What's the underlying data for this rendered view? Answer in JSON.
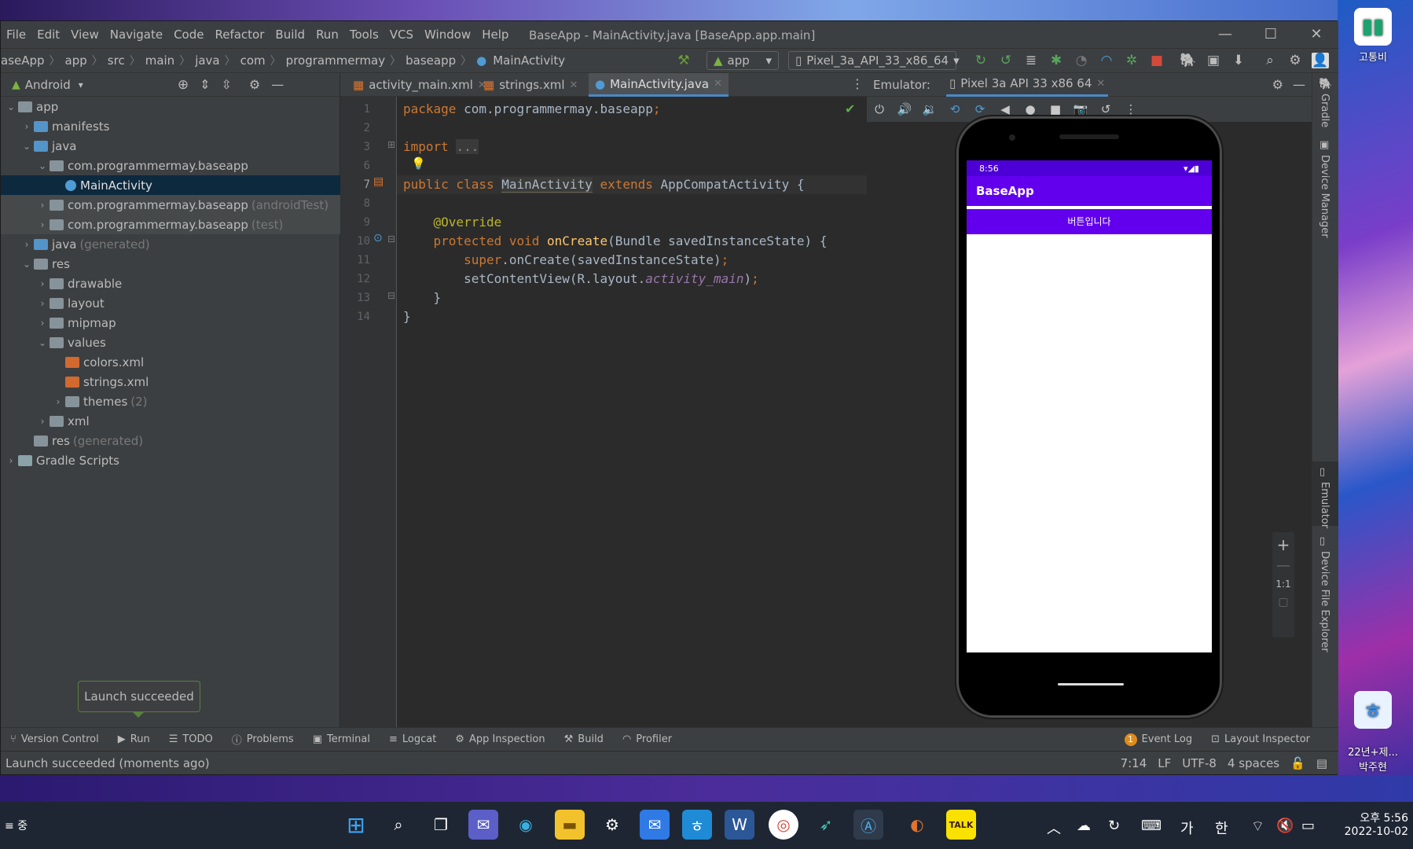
{
  "desktop": {
    "icons": [
      {
        "label": "고통비",
        "icon": "chart-icon",
        "color": "#1aa36f"
      },
      {
        "label": "22년+제...\n박주현",
        "icon": "hwp-icon",
        "color": "#3a8ee6"
      }
    ]
  },
  "menubar": {
    "items": [
      "File",
      "Edit",
      "View",
      "Navigate",
      "Code",
      "Refactor",
      "Build",
      "Run",
      "Tools",
      "VCS",
      "Window",
      "Help"
    ],
    "title": "BaseApp - MainActivity.java [BaseApp.app.main]"
  },
  "navbar": {
    "crumbs": [
      "aseApp",
      "app",
      "src",
      "main",
      "java",
      "com",
      "programmermay",
      "baseapp",
      "MainActivity"
    ],
    "run_config": "app",
    "device": "Pixel_3a_API_33_x86_64"
  },
  "project": {
    "view_label": "Android",
    "tree": [
      {
        "label": "app",
        "hint": "",
        "indent": 0,
        "arrow": "v",
        "icon": "module"
      },
      {
        "label": "manifests",
        "hint": "",
        "indent": 1,
        "arrow": ">",
        "icon": "folder-blue"
      },
      {
        "label": "java",
        "hint": "",
        "indent": 1,
        "arrow": "v",
        "icon": "folder-blue"
      },
      {
        "label": "com.programmermay.baseapp",
        "hint": "",
        "indent": 2,
        "arrow": "v",
        "icon": "folder"
      },
      {
        "label": "MainActivity",
        "hint": "",
        "indent": 3,
        "arrow": "",
        "icon": "class"
      },
      {
        "label": "com.programmermay.baseapp",
        "hint": "(androidTest)",
        "indent": 2,
        "arrow": ">",
        "icon": "folder"
      },
      {
        "label": "com.programmermay.baseapp",
        "hint": "(test)",
        "indent": 2,
        "arrow": ">",
        "icon": "folder"
      },
      {
        "label": "java",
        "hint": "(generated)",
        "indent": 1,
        "arrow": ">",
        "icon": "folder-blue"
      },
      {
        "label": "res",
        "hint": "",
        "indent": 1,
        "arrow": "v",
        "icon": "folder"
      },
      {
        "label": "drawable",
        "hint": "",
        "indent": 2,
        "arrow": ">",
        "icon": "folder"
      },
      {
        "label": "layout",
        "hint": "",
        "indent": 2,
        "arrow": ">",
        "icon": "folder"
      },
      {
        "label": "mipmap",
        "hint": "",
        "indent": 2,
        "arrow": ">",
        "icon": "folder"
      },
      {
        "label": "values",
        "hint": "",
        "indent": 2,
        "arrow": "v",
        "icon": "folder"
      },
      {
        "label": "colors.xml",
        "hint": "",
        "indent": 3,
        "arrow": "",
        "icon": "xml"
      },
      {
        "label": "strings.xml",
        "hint": "",
        "indent": 3,
        "arrow": "",
        "icon": "xml"
      },
      {
        "label": "themes",
        "hint": "(2)",
        "indent": 3,
        "arrow": ">",
        "icon": "folder"
      },
      {
        "label": "xml",
        "hint": "",
        "indent": 2,
        "arrow": ">",
        "icon": "folder"
      },
      {
        "label": "res",
        "hint": "(generated)",
        "indent": 1,
        "arrow": "",
        "icon": "folder"
      },
      {
        "label": "Gradle Scripts",
        "hint": "",
        "indent": 0,
        "arrow": ">",
        "icon": "gradle"
      }
    ]
  },
  "editor": {
    "tabs": [
      {
        "label": "activity_main.xml",
        "active": false
      },
      {
        "label": "strings.xml",
        "active": false
      },
      {
        "label": "MainActivity.java",
        "active": true
      }
    ],
    "line_numbers": [
      "1",
      "2",
      "3",
      "6",
      "7",
      "8",
      "9",
      "10",
      "11",
      "12",
      "13",
      "14"
    ]
  },
  "emulator": {
    "label": "Emulator:",
    "device_tab": "Pixel 3a API 33 x86 64",
    "phone_time": "8:56",
    "app_title": "BaseApp",
    "button_text": "버튼입니다",
    "zoom_1to1": "1:1"
  },
  "side_tools": {
    "right": [
      "Gradle",
      "Device Manager",
      "Emulator",
      "Device File Explorer"
    ]
  },
  "bottom_tools": [
    "Version Control",
    "Run",
    "TODO",
    "Problems",
    "Terminal",
    "Logcat",
    "App Inspection",
    "Build",
    "Profiler"
  ],
  "bottom_right_tools": [
    "Event Log",
    "Layout Inspector"
  ],
  "event_count": "1",
  "toast": "Launch succeeded",
  "status": {
    "message": "Launch succeeded (moments ago)",
    "position": "7:14",
    "line_sep": "LF",
    "encoding": "UTF-8",
    "indent": "4 spaces"
  },
  "taskbar": {
    "left_text": "≡ 중",
    "ime": "가",
    "ime2": "한",
    "time": "오후 5:56",
    "date": "2022-10-02"
  }
}
